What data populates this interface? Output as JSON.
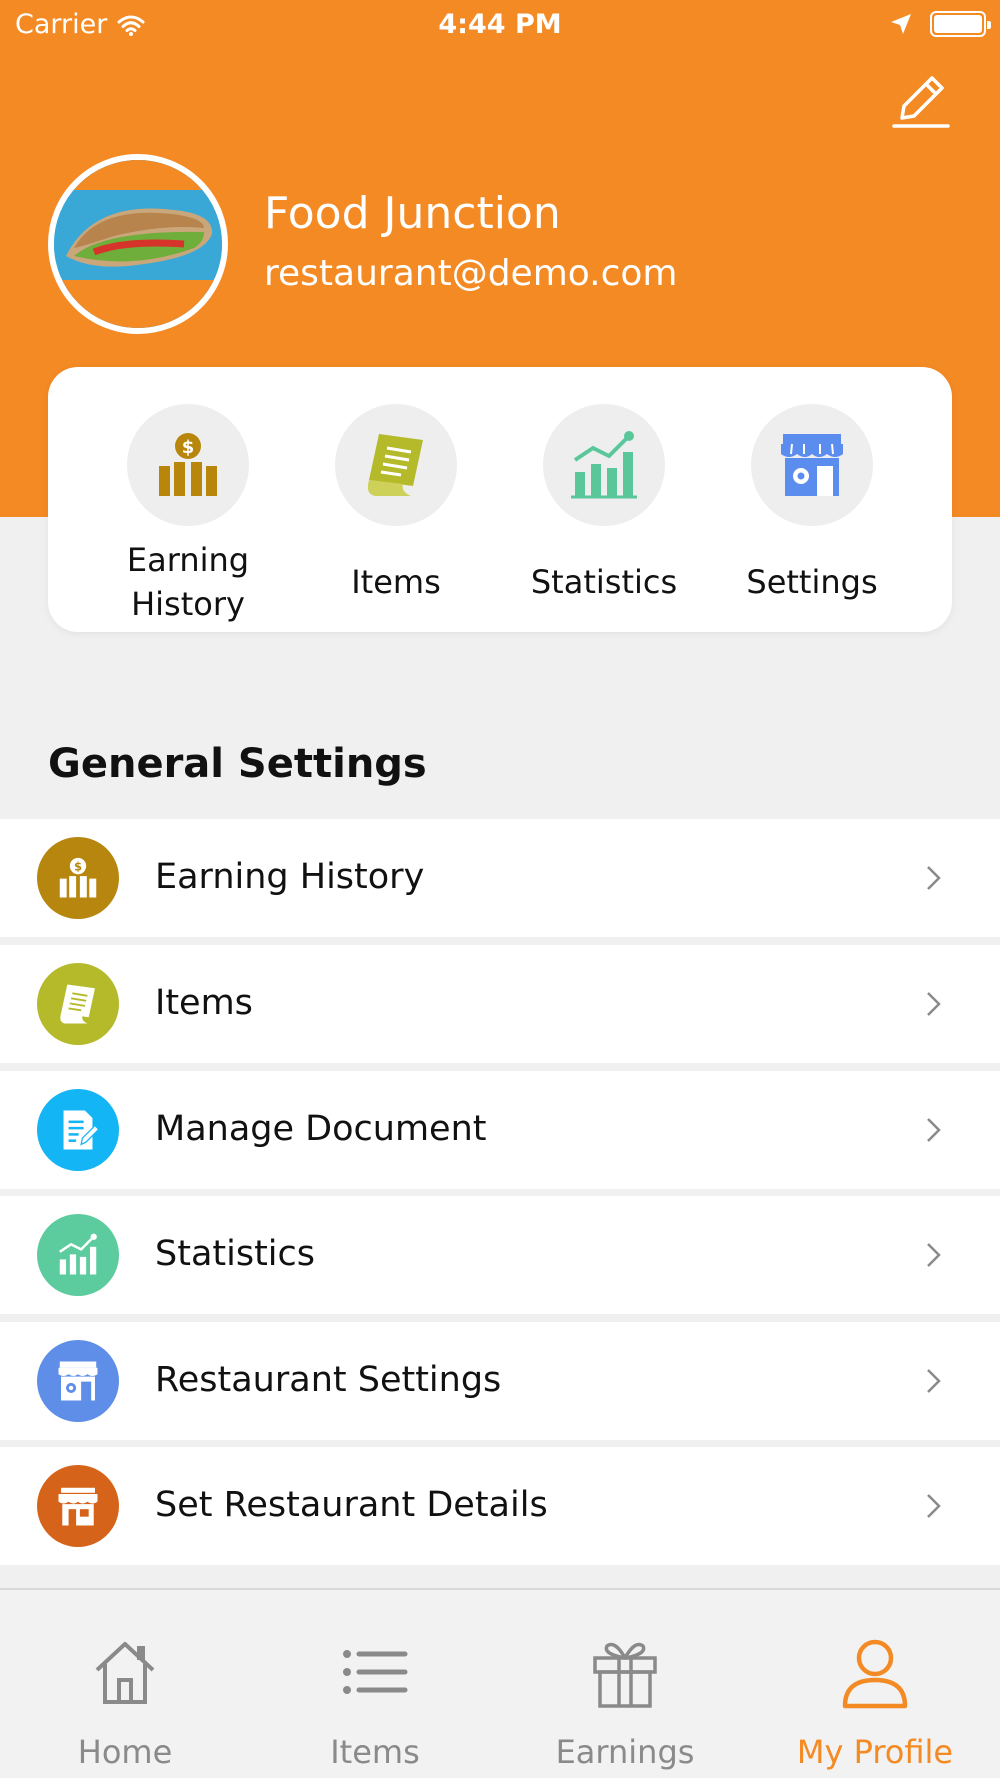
{
  "theme": {
    "accent": "#f48a24",
    "background": "#f0f0f0"
  },
  "status_bar": {
    "carrier": "Carrier",
    "time": "4:44 PM"
  },
  "profile": {
    "name": "Food Junction",
    "email": "restaurant@demo.com",
    "avatar_icon": "sandwich-photo"
  },
  "quick_actions": [
    {
      "label": "Earning\nHistory",
      "icon": "earning-history-icon",
      "color": "#b8860b"
    },
    {
      "label": "Items",
      "icon": "items-icon",
      "color": "#b5ba2a"
    },
    {
      "label": "Statistics",
      "icon": "statistics-icon",
      "color": "#5ac79a"
    },
    {
      "label": "Settings",
      "icon": "store-settings-icon",
      "color": "#5b8def"
    }
  ],
  "general_settings": {
    "title": "General Settings",
    "items": [
      {
        "label": "Earning History",
        "icon": "earning-history-icon",
        "color": "#b7860f"
      },
      {
        "label": "Items",
        "icon": "items-icon",
        "color": "#b5ba2a"
      },
      {
        "label": "Manage Document",
        "icon": "document-icon",
        "color": "#14b5f4"
      },
      {
        "label": "Statistics",
        "icon": "statistics-icon",
        "color": "#5ccb9e"
      },
      {
        "label": "Restaurant Settings",
        "icon": "store-settings-icon",
        "color": "#5f8ee8"
      },
      {
        "label": "Set Restaurant Details",
        "icon": "store-icon",
        "color": "#d5641a"
      }
    ]
  },
  "tab_bar": {
    "tabs": [
      {
        "label": "Home",
        "icon": "home-icon"
      },
      {
        "label": "Items",
        "icon": "list-icon"
      },
      {
        "label": "Earnings",
        "icon": "gift-icon"
      },
      {
        "label": "My Profile",
        "icon": "user-icon",
        "active": true
      }
    ]
  }
}
